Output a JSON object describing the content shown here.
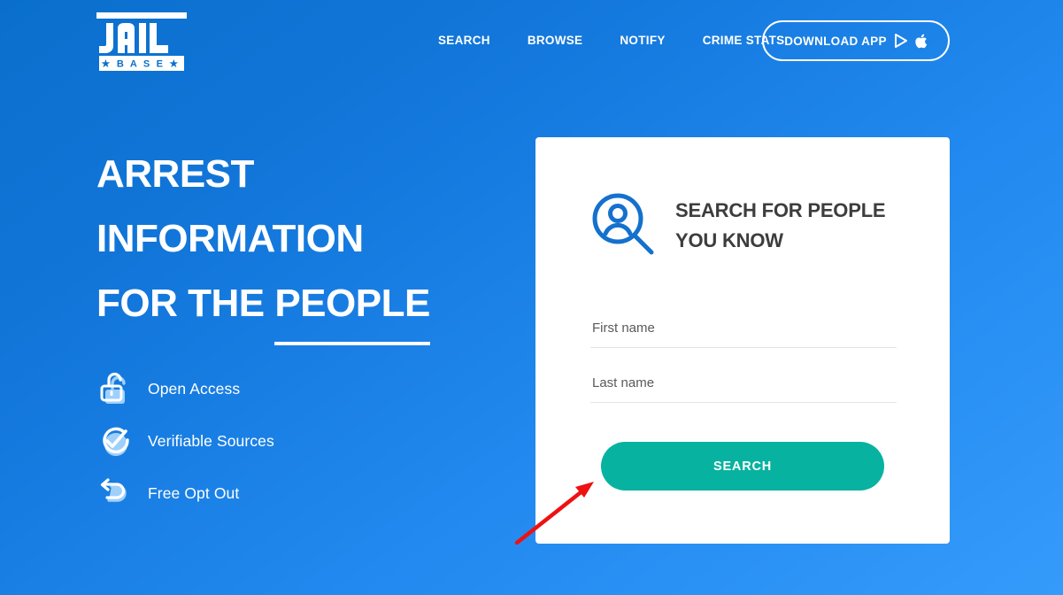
{
  "site": {
    "logo_primary": "JAIL",
    "logo_secondary": "BASE",
    "logo_alt": "JAILBASE"
  },
  "header": {
    "nav": [
      {
        "label": "SEARCH"
      },
      {
        "label": "BROWSE"
      },
      {
        "label": "NOTIFY"
      },
      {
        "label": "CRIME STATS"
      }
    ],
    "download": {
      "label": "DOWNLOAD APP",
      "icons": [
        "google-play-icon",
        "apple-icon"
      ]
    }
  },
  "hero": {
    "line1": "ARREST",
    "line2": "INFORMATION",
    "line3_prefix": "FOR THE ",
    "line3_underlined": "PEOPLE",
    "features": [
      {
        "icon": "open-padlock-icon",
        "label": "Open Access"
      },
      {
        "icon": "check-circle-icon",
        "label": "Verifiable Sources"
      },
      {
        "icon": "back-arrow-icon",
        "label": "Free Opt Out"
      }
    ]
  },
  "search_card": {
    "icon": "person-search-icon",
    "title": "SEARCH FOR PEOPLE YOU KNOW",
    "first_name": {
      "placeholder": "First name",
      "value": ""
    },
    "last_name": {
      "placeholder": "Last name",
      "value": ""
    },
    "submit_label": "SEARCH"
  },
  "annotation": {
    "type": "arrow",
    "color": "#ee1111",
    "points_to": "search-button"
  },
  "colors": {
    "background_top": "#0a6fcc",
    "background_bottom": "#359bfb",
    "accent_teal": "#07b2a0",
    "card_background": "#ffffff",
    "title_text": "#3d3d3d",
    "icon_blue": "#1471cd"
  }
}
